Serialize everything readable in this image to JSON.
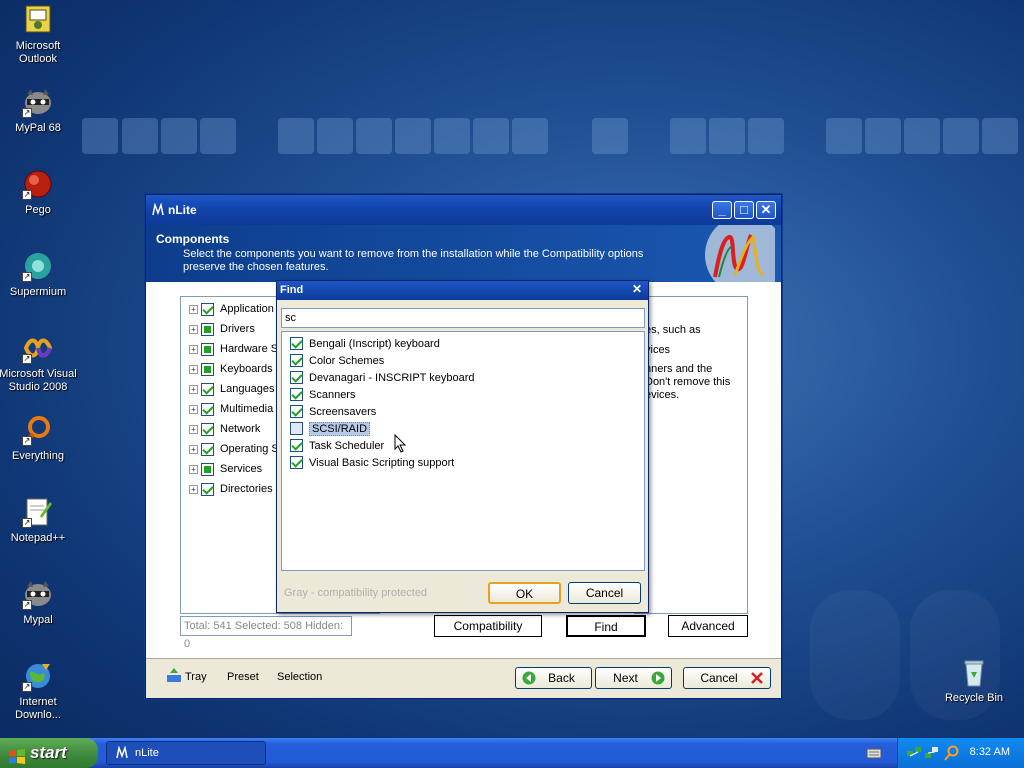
{
  "desktop": {
    "icons": [
      {
        "label": "Microsoft Outlook"
      },
      {
        "label": "MyPal 68"
      },
      {
        "label": "Pego"
      },
      {
        "label": "Supermium"
      },
      {
        "label": "Microsoft Visual Studio 2008"
      },
      {
        "label": "Everything"
      },
      {
        "label": "Notepad++"
      },
      {
        "label": "Mypal"
      },
      {
        "label": "Internet Downlo..."
      },
      {
        "label": "Recycle Bin"
      }
    ]
  },
  "nlite": {
    "title": "nLite",
    "header_title": "Components",
    "header_desc": "Select the components you want to remove from the installation while the Compatibility options preserve the chosen features.",
    "tree": [
      {
        "label": "Application",
        "state": "checked"
      },
      {
        "label": "Drivers",
        "state": "partial"
      },
      {
        "label": "Hardware S",
        "state": "partial"
      },
      {
        "label": "Keyboards",
        "state": "partial"
      },
      {
        "label": "Languages",
        "state": "checked"
      },
      {
        "label": "Multimedia",
        "state": "checked"
      },
      {
        "label": "Network",
        "state": "checked"
      },
      {
        "label": "Operating S",
        "state": "checked"
      },
      {
        "label": "Services",
        "state": "partial"
      },
      {
        "label": "Directories",
        "state": "checked"
      }
    ],
    "desc_lines": [
      "es, such as",
      "vices",
      "nners and the",
      "Don't remove this",
      "evices."
    ],
    "status_total": "Total: 541  Selected: 508  Hidden: 0",
    "compat_btn": "Compatibility",
    "find_btn": "Find",
    "advanced_btn": "Advanced",
    "tray_label": "Tray",
    "preset_label": "Preset",
    "selection_label": "Selection",
    "back_btn": "Back",
    "next_btn": "Next",
    "cancel_btn": "Cancel"
  },
  "find": {
    "title": "Find",
    "query": "sc",
    "results": [
      {
        "label": "Bengali (Inscript) keyboard",
        "checked": true
      },
      {
        "label": "Color Schemes",
        "checked": true
      },
      {
        "label": "Devanagari - INSCRIPT keyboard",
        "checked": true
      },
      {
        "label": "Scanners",
        "checked": true
      },
      {
        "label": "Screensavers",
        "checked": true
      },
      {
        "label": "SCSI/RAID",
        "checked": false
      },
      {
        "label": "Task Scheduler",
        "checked": true
      },
      {
        "label": "Visual Basic Scripting support",
        "checked": true
      }
    ],
    "hint": "Gray - compatibility protected",
    "ok_btn": "OK",
    "cancel_btn": "Cancel"
  },
  "taskbar": {
    "start_label": "start",
    "task_label": "nLite",
    "clock": "8:32 AM"
  }
}
